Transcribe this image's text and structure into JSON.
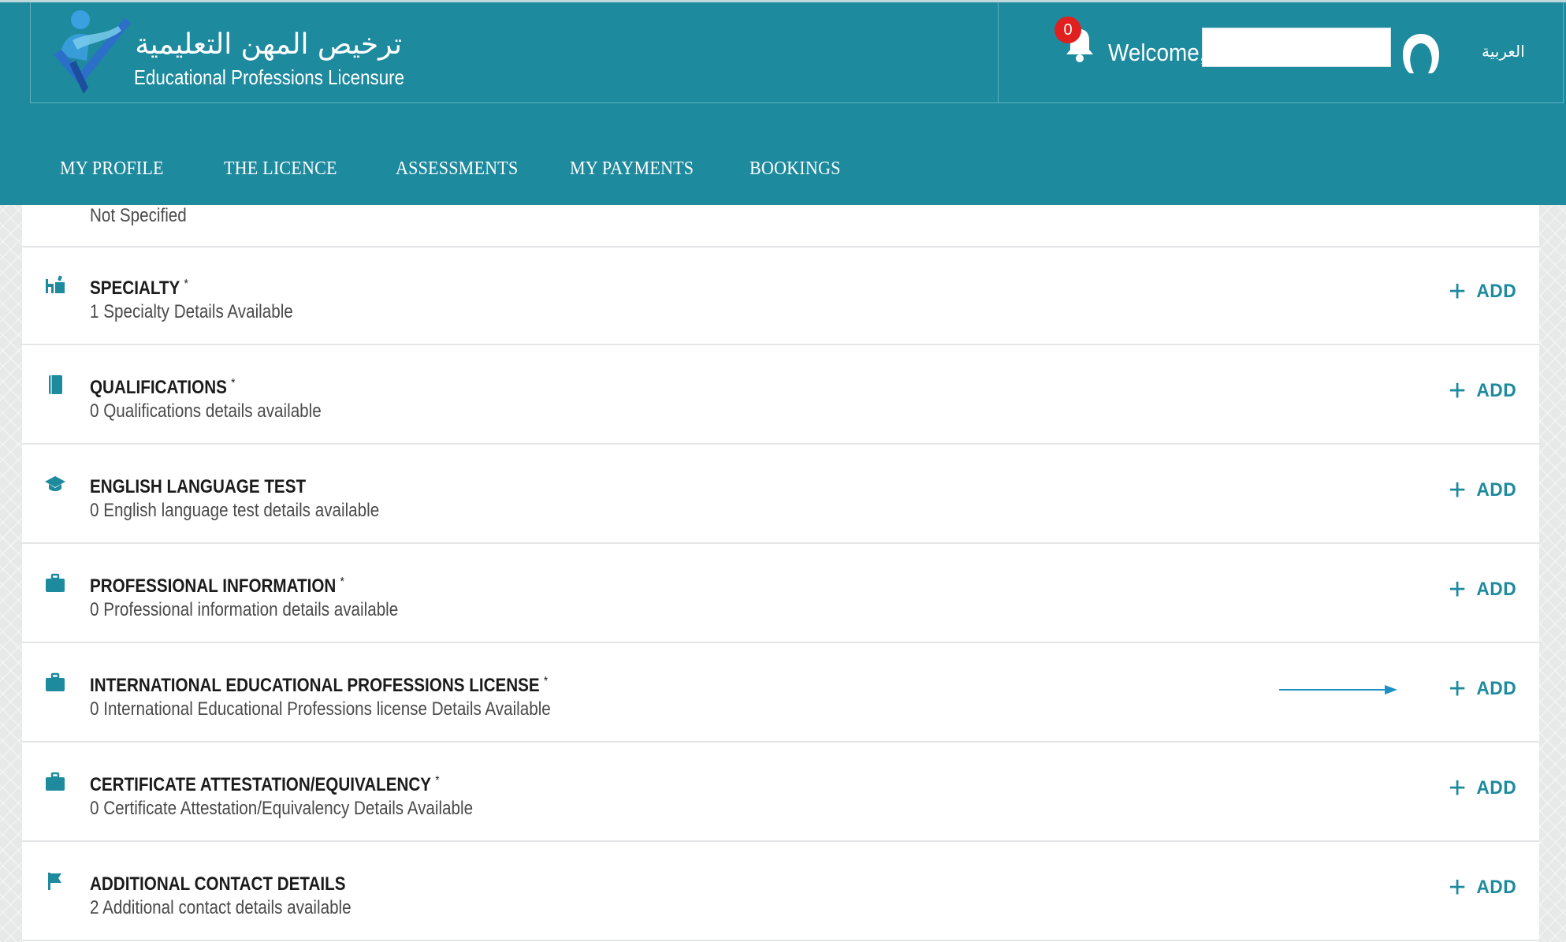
{
  "header": {
    "logo_arabic": "ترخيص المهن التعليمية",
    "logo_english": "Educational Professions Licensure",
    "notification_count": "0",
    "welcome_text": "Welcome,",
    "welcome_name": "",
    "language_toggle": "العربية"
  },
  "nav": {
    "items": [
      {
        "label": "MY PROFILE"
      },
      {
        "label": "THE LICENCE"
      },
      {
        "label": "ASSESSMENTS"
      },
      {
        "label": "MY PAYMENTS"
      },
      {
        "label": "BOOKINGS"
      }
    ]
  },
  "profile": {
    "top_remnant": "Not Specified",
    "sections": [
      {
        "title": "SPECIALTY",
        "required": "*",
        "subtitle": "1 Specialty Details Available",
        "add_label": "ADD",
        "icon": "desk-chair-icon"
      },
      {
        "title": "QUALIFICATIONS",
        "required": "*",
        "subtitle": "0 Qualifications details available",
        "add_label": "ADD",
        "icon": "book-icon"
      },
      {
        "title": "ENGLISH LANGUAGE TEST",
        "required": "",
        "subtitle": "0 English language test details available",
        "add_label": "ADD",
        "icon": "graduation-cap-icon"
      },
      {
        "title": "PROFESSIONAL INFORMATION",
        "required": "*",
        "subtitle": "0 Professional information details available",
        "add_label": "ADD",
        "icon": "briefcase-icon"
      },
      {
        "title": "INTERNATIONAL EDUCATIONAL PROFESSIONS LICENSE",
        "required": "*",
        "subtitle": "0 International Educational Professions license Details Available",
        "add_label": "ADD",
        "icon": "briefcase-icon"
      },
      {
        "title": "CERTIFICATE ATTESTATION/EQUIVALENCY",
        "required": "*",
        "subtitle": "0 Certificate Attestation/Equivalency Details Available",
        "add_label": "ADD",
        "icon": "briefcase-icon"
      },
      {
        "title": "ADDITIONAL CONTACT DETAILS",
        "required": "",
        "subtitle": "2 Additional contact details available",
        "add_label": "ADD",
        "icon": "flag-icon"
      }
    ]
  },
  "colors": {
    "brand_teal": "#1d8a9e",
    "badge_red": "#e0201e",
    "annotation_arrow": "#1e8fc7"
  }
}
